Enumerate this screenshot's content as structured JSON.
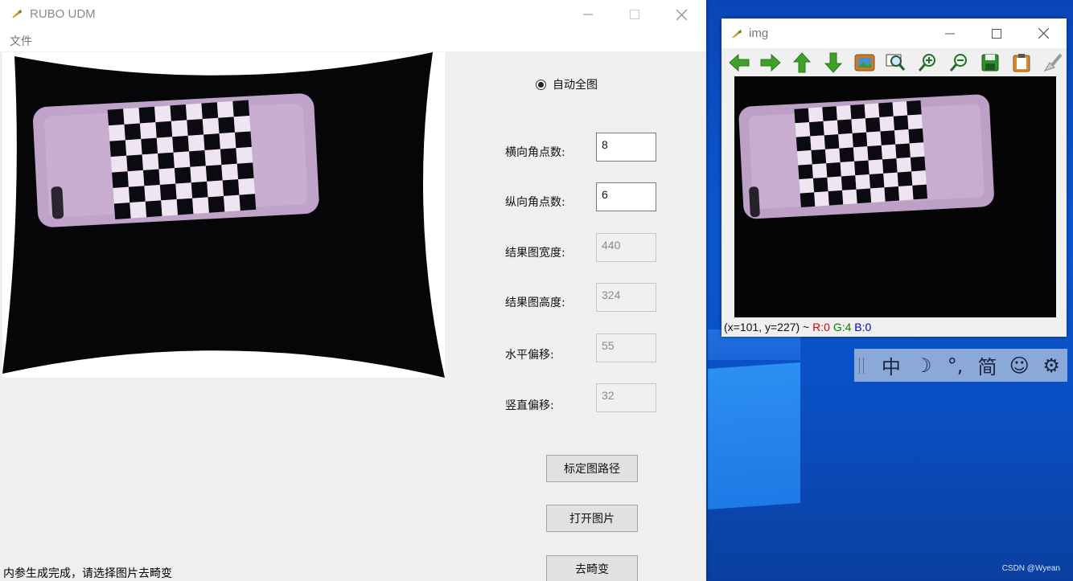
{
  "main_window": {
    "title": "RUBO UDM",
    "menu": {
      "file": "文件"
    },
    "radio": {
      "label": "自动全图",
      "checked": true
    },
    "fields": {
      "cols_label": "横向角点数:",
      "cols_value": "8",
      "rows_label": "纵向角点数:",
      "rows_value": "6",
      "width_label": "结果图宽度:",
      "width_value": "440",
      "height_label": "结果图高度:",
      "height_value": "324",
      "hshift_label": "水平偏移:",
      "hshift_value": "55",
      "vshift_label": "竖直偏移:",
      "vshift_value": "32"
    },
    "buttons": {
      "calib_path": "标定图路径",
      "open_image": "打开图片",
      "undistort": "去畸变"
    },
    "status": "内参生成完成，请选择图片去畸变"
  },
  "img_window": {
    "title": "img",
    "status": {
      "coords": "(x=101, y=227) ~ ",
      "r": "R:0",
      "g": "G:4",
      "b": "B:0"
    },
    "toolbar": [
      "arrow-left-icon",
      "arrow-right-icon",
      "arrow-up-icon",
      "arrow-down-icon",
      "image-icon",
      "zoom-fit-icon",
      "zoom-in-icon",
      "zoom-out-icon",
      "save-icon",
      "clipboard-icon",
      "brush-icon"
    ]
  },
  "ime": {
    "items": [
      "中",
      "☽",
      "°,",
      "简",
      "☺",
      "⚙"
    ]
  },
  "watermark": "CSDN @Wyean",
  "colors": {
    "desktop": "#0a4fc0",
    "window_bg": "#efefef",
    "red": "#e00000",
    "green": "#008000",
    "blue": "#0000d0"
  }
}
